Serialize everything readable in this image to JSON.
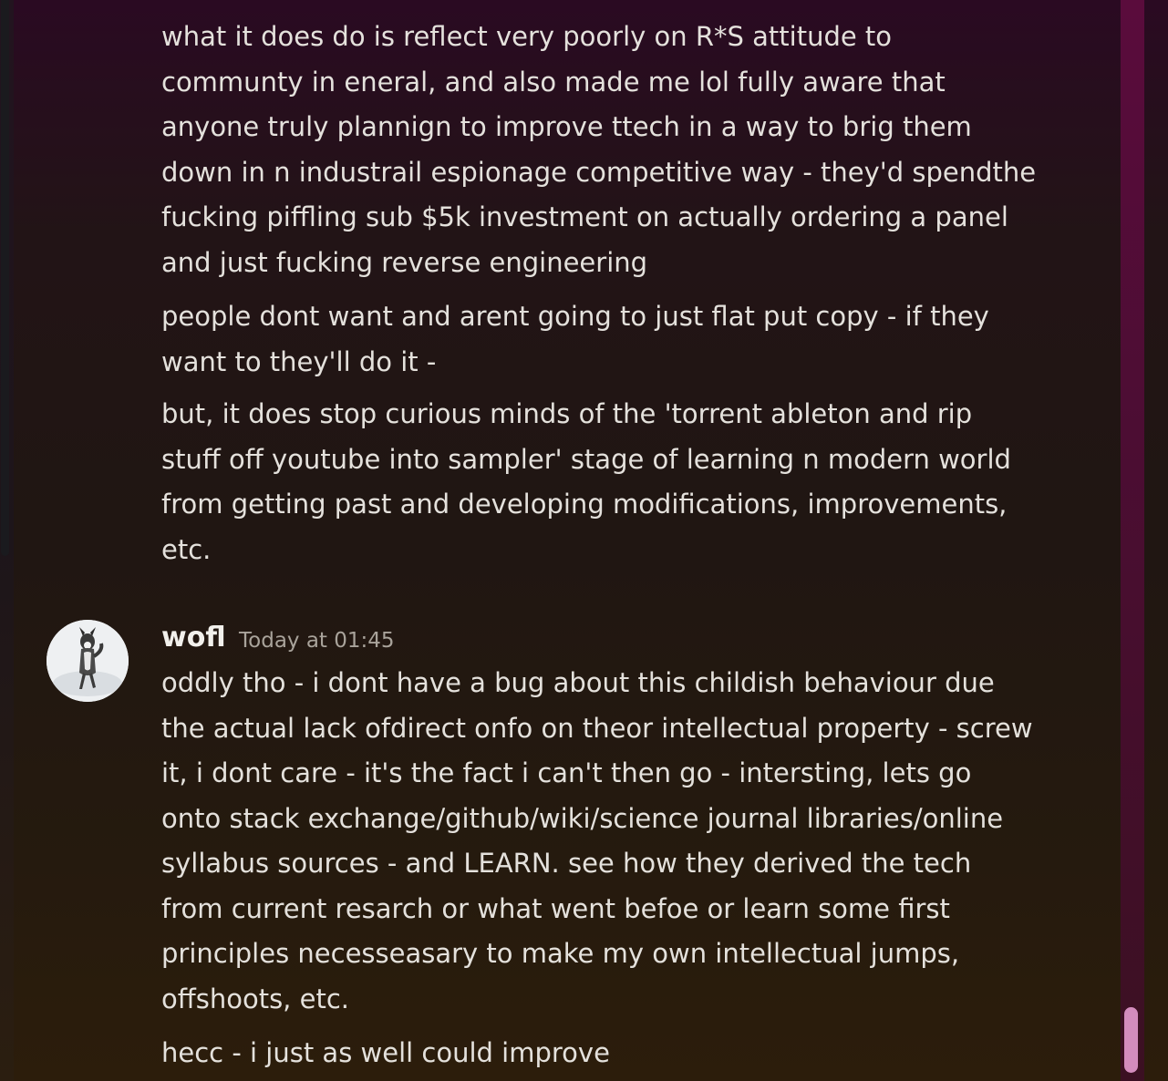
{
  "messages": {
    "previous": {
      "partial_top": "",
      "paragraphs": [
        "what it does do is reflect very poorly on R*S attitude to communty in eneral, and also made me lol fully aware that anyone truly plannign to improve ttech in a way to brig them down in n industrail espionage competitive way - they'd spendthe fucking piffling sub $5k investment on actually ordering a panel and just fucking reverse engineering",
        "people dont want and arent going to just flat put copy - if they want to they'll do it -",
        "but, it does stop curious minds of the 'torrent ableton and rip stuff off youtube into sampler' stage of learning n modern world from getting past and developing modifications, improvements, etc."
      ]
    },
    "current": {
      "username": "wofl",
      "timestamp": "Today at 01:45",
      "avatar_icon": "husky-dog-avatar",
      "paragraphs": [
        "oddly tho - i dont have a bug about this childish behaviour due the actual lack ofdirect onfo on theor intellectual property - screw it, i dont care - it's the fact i can't then go - intersting, lets go onto stack exchange/github/wiki/science journal libraries/online syllabus sources - and LEARN. see how they derived the tech from current resarch or what went befoe or learn some first principles necesseasary to make my own intellectual jumps, offshoots, etc.",
        "hecc - i just as well could improve"
      ]
    }
  },
  "colors": {
    "text": "#e4e1dc",
    "timestamp": "#a9a39b",
    "scroll_thumb": "#d38cbd"
  }
}
